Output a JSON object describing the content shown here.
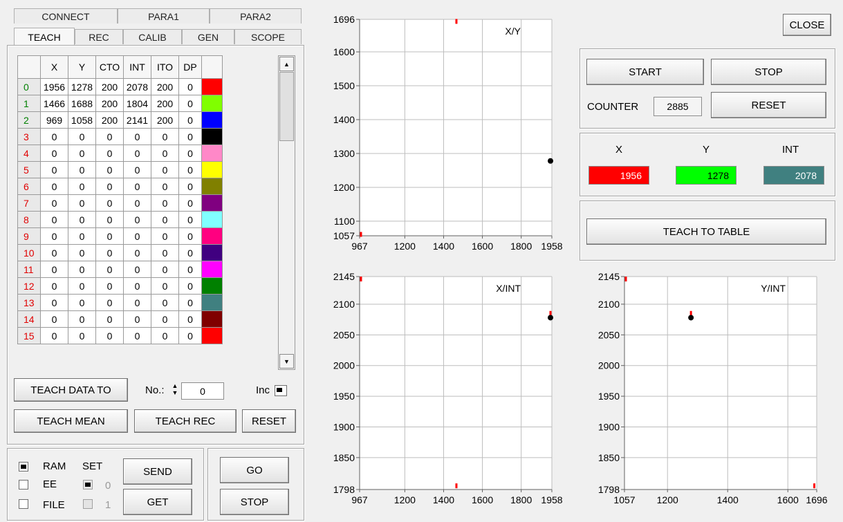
{
  "tabs_top": [
    "CONNECT",
    "PARA1",
    "PARA2"
  ],
  "tabs_bottom": [
    "TEACH",
    "REC",
    "CALIB",
    "GEN",
    "SCOPE"
  ],
  "table": {
    "headers": [
      "",
      "X",
      "Y",
      "CTO",
      "INT",
      "ITO",
      "DP",
      ""
    ],
    "rows": [
      {
        "no": "0",
        "x": "1956",
        "y": "1278",
        "cto": "200",
        "int": "2078",
        "ito": "200",
        "dp": "0",
        "color": "#ff0000",
        "nocolor": "#008000"
      },
      {
        "no": "1",
        "x": "1466",
        "y": "1688",
        "cto": "200",
        "int": "1804",
        "ito": "200",
        "dp": "0",
        "color": "#80ff00",
        "nocolor": "#008000"
      },
      {
        "no": "2",
        "x": "969",
        "y": "1058",
        "cto": "200",
        "int": "2141",
        "ito": "200",
        "dp": "0",
        "color": "#0000ff",
        "nocolor": "#008000"
      },
      {
        "no": "3",
        "x": "0",
        "y": "0",
        "cto": "0",
        "int": "0",
        "ito": "0",
        "dp": "0",
        "color": "#000000",
        "nocolor": "#e00000"
      },
      {
        "no": "4",
        "x": "0",
        "y": "0",
        "cto": "0",
        "int": "0",
        "ito": "0",
        "dp": "0",
        "color": "#ff88c8",
        "nocolor": "#e00000"
      },
      {
        "no": "5",
        "x": "0",
        "y": "0",
        "cto": "0",
        "int": "0",
        "ito": "0",
        "dp": "0",
        "color": "#ffff00",
        "nocolor": "#e00000"
      },
      {
        "no": "6",
        "x": "0",
        "y": "0",
        "cto": "0",
        "int": "0",
        "ito": "0",
        "dp": "0",
        "color": "#808000",
        "nocolor": "#e00000"
      },
      {
        "no": "7",
        "x": "0",
        "y": "0",
        "cto": "0",
        "int": "0",
        "ito": "0",
        "dp": "0",
        "color": "#800080",
        "nocolor": "#e00000"
      },
      {
        "no": "8",
        "x": "0",
        "y": "0",
        "cto": "0",
        "int": "0",
        "ito": "0",
        "dp": "0",
        "color": "#80ffff",
        "nocolor": "#e00000"
      },
      {
        "no": "9",
        "x": "0",
        "y": "0",
        "cto": "0",
        "int": "0",
        "ito": "0",
        "dp": "0",
        "color": "#ff0080",
        "nocolor": "#e00000"
      },
      {
        "no": "10",
        "x": "0",
        "y": "0",
        "cto": "0",
        "int": "0",
        "ito": "0",
        "dp": "0",
        "color": "#400080",
        "nocolor": "#e00000"
      },
      {
        "no": "11",
        "x": "0",
        "y": "0",
        "cto": "0",
        "int": "0",
        "ito": "0",
        "dp": "0",
        "color": "#ff00ff",
        "nocolor": "#e00000"
      },
      {
        "no": "12",
        "x": "0",
        "y": "0",
        "cto": "0",
        "int": "0",
        "ito": "0",
        "dp": "0",
        "color": "#008000",
        "nocolor": "#e00000"
      },
      {
        "no": "13",
        "x": "0",
        "y": "0",
        "cto": "0",
        "int": "0",
        "ito": "0",
        "dp": "0",
        "color": "#408080",
        "nocolor": "#e00000"
      },
      {
        "no": "14",
        "x": "0",
        "y": "0",
        "cto": "0",
        "int": "0",
        "ito": "0",
        "dp": "0",
        "color": "#800000",
        "nocolor": "#e00000"
      },
      {
        "no": "15",
        "x": "0",
        "y": "0",
        "cto": "0",
        "int": "0",
        "ito": "0",
        "dp": "0",
        "color": "#ff0000",
        "nocolor": "#e00000"
      }
    ]
  },
  "teach": {
    "teach_data_to": "TEACH DATA TO",
    "no_label": "No.:",
    "no_value": "0",
    "inc_label": "Inc",
    "teach_mean": "TEACH MEAN",
    "teach_rec": "TEACH REC",
    "reset": "RESET"
  },
  "memory": {
    "ram": "RAM",
    "ee": "EE",
    "file": "FILE",
    "set": "SET",
    "set0": "0",
    "set1": "1",
    "send": "SEND",
    "get": "GET",
    "go": "GO",
    "stop": "STOP"
  },
  "right": {
    "close": "CLOSE",
    "start": "START",
    "stop": "STOP",
    "counter_label": "COUNTER",
    "counter_value": "2885",
    "reset": "RESET",
    "x_label": "X",
    "y_label": "Y",
    "int_label": "INT",
    "x_value": "1956",
    "y_value": "1278",
    "int_value": "2078",
    "x_color": "#ff0000",
    "y_color": "#00ff00",
    "int_color": "#408080",
    "teach_to_table": "TEACH TO TABLE"
  },
  "chart_data": [
    {
      "type": "scatter",
      "title": "X/Y",
      "xlim": [
        967,
        1958
      ],
      "ylim": [
        1057,
        1696
      ],
      "x_ticks": [
        "967",
        "1200",
        "1400",
        "1600",
        "1800",
        "1958"
      ],
      "y_ticks": [
        "1057",
        "1100",
        "1200",
        "1300",
        "1400",
        "1500",
        "1600",
        "1696"
      ],
      "series": [
        {
          "color": "#ff0000",
          "points": [
            [
              1466,
              1690
            ],
            [
              969,
              1058
            ]
          ]
        },
        {
          "color": "#000000",
          "points": [
            [
              1956,
              1278
            ]
          ]
        }
      ]
    },
    {
      "type": "scatter",
      "title": "X/INT",
      "xlim": [
        967,
        1958
      ],
      "ylim": [
        1798,
        2145
      ],
      "x_ticks": [
        "967",
        "1200",
        "1400",
        "1600",
        "1800",
        "1958"
      ],
      "y_ticks": [
        "1798",
        "1850",
        "1900",
        "1950",
        "2000",
        "2050",
        "2100",
        "2145"
      ],
      "series": [
        {
          "color": "#ff0000",
          "points": [
            [
              969,
              2141
            ],
            [
              1466,
              1804
            ],
            [
              1956,
              2085
            ]
          ]
        },
        {
          "color": "#000000",
          "points": [
            [
              1956,
              2078
            ]
          ]
        }
      ]
    },
    {
      "type": "scatter",
      "title": "Y/INT",
      "xlim": [
        1057,
        1696
      ],
      "ylim": [
        1798,
        2145
      ],
      "x_ticks": [
        "1057",
        "1200",
        "1400",
        "1600",
        "1696"
      ],
      "y_ticks": [
        "1798",
        "1850",
        "1900",
        "1950",
        "2000",
        "2050",
        "2100",
        "2145"
      ],
      "series": [
        {
          "color": "#ff0000",
          "points": [
            [
              1058,
              2141
            ],
            [
              1688,
              1804
            ],
            [
              1278,
              2085
            ]
          ]
        },
        {
          "color": "#000000",
          "points": [
            [
              1278,
              2078
            ]
          ]
        }
      ]
    }
  ]
}
